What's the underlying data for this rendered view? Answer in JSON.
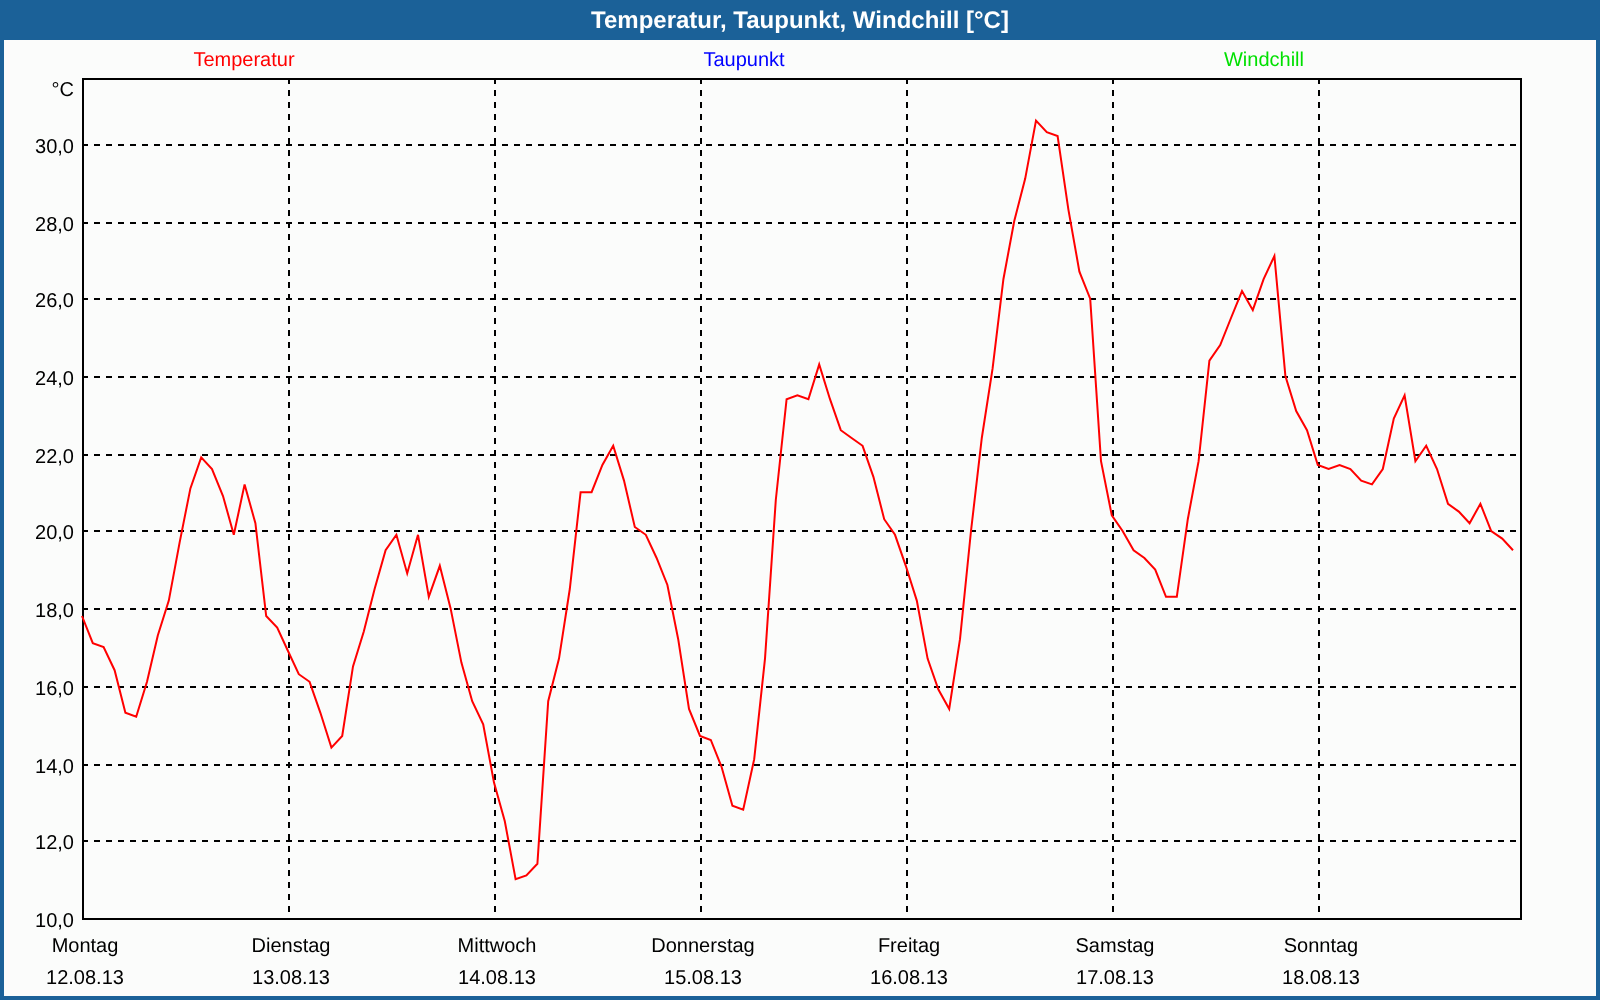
{
  "window": {
    "title": "Temperatur, Taupunkt, Windchill [°C]"
  },
  "chart": {
    "x_dates": [
      "12.08.13",
      "13.08.13",
      "14.08.13",
      "15.08.13",
      "16.08.13",
      "17.08.13",
      "18.08.13"
    ],
    "chart_data": {
      "type": "line",
      "grid": true,
      "ylabel": "°C",
      "ylim": [
        10,
        31.7
      ],
      "categories": [
        "Montag",
        null,
        null,
        null,
        null,
        null,
        null,
        null,
        null,
        null,
        null,
        null,
        null,
        null,
        null,
        null,
        null,
        null,
        null,
        "Dienstag",
        null,
        null,
        null,
        null,
        null,
        null,
        null,
        null,
        null,
        null,
        null,
        null,
        null,
        null,
        null,
        null,
        null,
        null,
        "Mittwoch",
        null,
        null,
        null,
        null,
        null,
        null,
        null,
        null,
        null,
        null,
        null,
        null,
        null,
        null,
        null,
        null,
        null,
        null,
        "Donnerstag",
        null,
        null,
        null,
        null,
        null,
        null,
        null,
        null,
        null,
        null,
        null,
        null,
        null,
        null,
        null,
        null,
        null,
        null,
        "Freitag",
        null,
        null,
        null,
        null,
        null,
        null,
        null,
        null,
        null,
        null,
        null,
        null,
        null,
        null,
        null,
        null,
        null,
        null,
        "Samstag",
        null,
        null,
        null,
        null,
        null,
        null,
        null,
        null,
        null,
        null,
        null,
        null,
        null,
        null,
        null,
        null,
        null,
        null,
        "Sonntag",
        null,
        null,
        null,
        null,
        null,
        null,
        null,
        null,
        null,
        null,
        null,
        null,
        null,
        null,
        null,
        null,
        null,
        null
      ],
      "yticks": [
        {
          "value": 10,
          "label": "10,0"
        },
        {
          "value": 12,
          "label": "12,0"
        },
        {
          "value": 14,
          "label": "14,0"
        },
        {
          "value": 16,
          "label": "16,0"
        },
        {
          "value": 18,
          "label": "18,0"
        },
        {
          "value": 20,
          "label": "20,0"
        },
        {
          "value": 22,
          "label": "22,0"
        },
        {
          "value": 24,
          "label": "24,0"
        },
        {
          "value": 26,
          "label": "26,0"
        },
        {
          "value": 28,
          "label": "28,0"
        },
        {
          "value": 30,
          "label": "30,0"
        }
      ],
      "series": [
        {
          "name": "Temperatur",
          "color": "#ff0000",
          "values": [
            17.8,
            17.1,
            17,
            16.4,
            15.3,
            15.2,
            16.1,
            17.3,
            18.2,
            19.7,
            21.1,
            21.9,
            21.6,
            20.9,
            19.9,
            21.2,
            20.2,
            17.8,
            17.5,
            16.9,
            16.3,
            16.1,
            15.3,
            14.4,
            14.7,
            16.5,
            17.4,
            18.5,
            19.5,
            19.9,
            18.9,
            19.9,
            18.3,
            19.1,
            18,
            16.6,
            15.6,
            15,
            13.5,
            12.5,
            11,
            11.1,
            11.4,
            15.6,
            16.7,
            18.5,
            21,
            21,
            21.7,
            22.2,
            21.3,
            20.1,
            19.9,
            19.3,
            18.6,
            17.2,
            15.4,
            14.7,
            14.6,
            13.9,
            12.9,
            12.8,
            14.1,
            16.7,
            20.8,
            23.4,
            23.5,
            23.4,
            24.3,
            23.4,
            22.6,
            22.4,
            22.2,
            21.4,
            20.3,
            19.9,
            19.1,
            18.2,
            16.7,
            15.9,
            15.4,
            17.2,
            20,
            22.4,
            24.2,
            26.5,
            28,
            29.1,
            30.6,
            30.3,
            30.2,
            28.3,
            26.7,
            26,
            21.8,
            20.4,
            20,
            19.5,
            19.3,
            19,
            18.3,
            18.3,
            20.3,
            21.8,
            24.4,
            24.8,
            25.5,
            26.2,
            25.7,
            26.5,
            27.1,
            24,
            23.1,
            22.6,
            21.7,
            21.6,
            21.7,
            21.6,
            21.3,
            21.2,
            21.6,
            22.9,
            23.5,
            21.8,
            22.2,
            21.6,
            20.7,
            20.5,
            20.2,
            20.7,
            20,
            19.8,
            19.5
          ]
        },
        {
          "name": "Taupunkt",
          "color": "#0000ff",
          "values": [
            null,
            null,
            null,
            null,
            null,
            null,
            null,
            null,
            null,
            null,
            null,
            null,
            null,
            null,
            null,
            null,
            null,
            null,
            null,
            null,
            null,
            null,
            null,
            null,
            null,
            null,
            null,
            null,
            null,
            null,
            null,
            null,
            null,
            null,
            null,
            null,
            null,
            null,
            null,
            null,
            null,
            null,
            null,
            null,
            null,
            null,
            null,
            null,
            null,
            null,
            null,
            null,
            null,
            null,
            null,
            null,
            null,
            null,
            null,
            null,
            null,
            null,
            null,
            null,
            null,
            null,
            null,
            null,
            null,
            null,
            null,
            null,
            null,
            null,
            null,
            null,
            null,
            null,
            null,
            null,
            null,
            null,
            null,
            null,
            null,
            null,
            null,
            null,
            null,
            null,
            null,
            null,
            null,
            null,
            null,
            null,
            null,
            null,
            null,
            null,
            null,
            null,
            null,
            null,
            null,
            null,
            null,
            null,
            null,
            null,
            null,
            null,
            null,
            null,
            null,
            null,
            null,
            null,
            null,
            null,
            null,
            null,
            null,
            null,
            null,
            null,
            null,
            null,
            null,
            null,
            null,
            null,
            null
          ]
        },
        {
          "name": "Windchill",
          "color": "#00e000",
          "values": [
            null,
            null,
            null,
            null,
            null,
            null,
            null,
            null,
            null,
            null,
            null,
            null,
            null,
            null,
            null,
            null,
            null,
            null,
            null,
            null,
            null,
            null,
            null,
            null,
            null,
            null,
            null,
            null,
            null,
            null,
            null,
            null,
            null,
            null,
            null,
            null,
            null,
            null,
            null,
            null,
            null,
            null,
            null,
            null,
            null,
            null,
            null,
            null,
            null,
            null,
            null,
            null,
            null,
            null,
            null,
            null,
            null,
            null,
            null,
            null,
            null,
            null,
            null,
            null,
            null,
            null,
            null,
            null,
            null,
            null,
            null,
            null,
            null,
            null,
            null,
            null,
            null,
            null,
            null,
            null,
            null,
            null,
            null,
            null,
            null,
            null,
            null,
            null,
            null,
            null,
            null,
            null,
            null,
            null,
            null,
            null,
            null,
            null,
            null,
            null,
            null,
            null,
            null,
            null,
            null,
            null,
            null,
            null,
            null,
            null,
            null,
            null,
            null,
            null,
            null,
            null,
            null,
            null,
            null,
            null,
            null,
            null,
            null,
            null,
            null,
            null,
            null,
            null,
            null,
            null,
            null,
            null,
            null
          ]
        }
      ]
    }
  }
}
